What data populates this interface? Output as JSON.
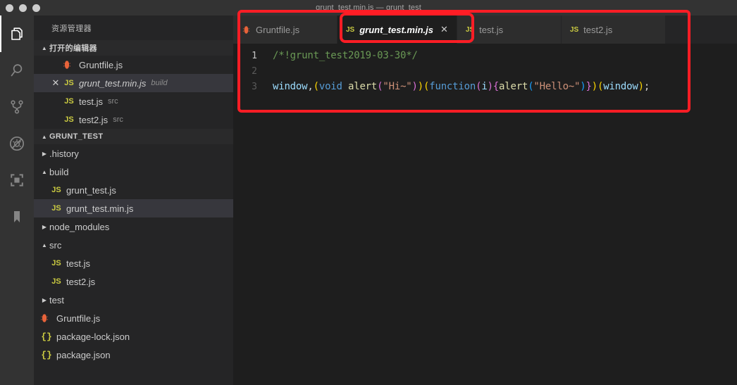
{
  "titlebar": {
    "title": "grunt_test.min.js — grunt_test",
    "window_controls": [
      "close",
      "minimize",
      "maximize"
    ]
  },
  "activitybar": {
    "items": [
      {
        "name": "explorer",
        "icon": "files-icon",
        "active": true
      },
      {
        "name": "search",
        "icon": "search-icon",
        "active": false
      },
      {
        "name": "source-control",
        "icon": "source-control-icon",
        "active": false
      },
      {
        "name": "debug",
        "icon": "debug-no-icon",
        "active": false
      },
      {
        "name": "extensions",
        "icon": "extensions-icon",
        "active": false
      },
      {
        "name": "bookmarks",
        "icon": "bookmark-icon",
        "active": false
      }
    ]
  },
  "sidebar": {
    "title": "资源管理器",
    "open_editors": {
      "header": "打开的编辑器",
      "twisty": "▲",
      "items": [
        {
          "icon": "grunt-icon",
          "name": "Gruntfile.js",
          "desc": "",
          "selected": false,
          "dirty": false,
          "italic": false
        },
        {
          "icon": "js-icon",
          "name": "grunt_test.min.js",
          "desc": "build",
          "selected": true,
          "dirty": false,
          "italic": true
        },
        {
          "icon": "js-icon",
          "name": "test.js",
          "desc": "src",
          "selected": false,
          "dirty": false,
          "italic": false
        },
        {
          "icon": "js-icon",
          "name": "test2.js",
          "desc": "src",
          "selected": false,
          "dirty": false,
          "italic": false
        }
      ]
    },
    "workspace": {
      "header": "GRUNT_TEST",
      "twisty": "▲",
      "items": [
        {
          "type": "folder",
          "name": ".history",
          "expanded": false,
          "selected": false,
          "icon": "chevron-right-icon",
          "indent": 1
        },
        {
          "type": "folder",
          "name": "build",
          "expanded": true,
          "selected": false,
          "icon": "chevron-down-icon",
          "indent": 1
        },
        {
          "type": "file",
          "name": "grunt_test.js",
          "selected": false,
          "icon": "js-icon",
          "indent": 2
        },
        {
          "type": "file",
          "name": "grunt_test.min.js",
          "selected": true,
          "icon": "js-icon",
          "indent": 2
        },
        {
          "type": "folder",
          "name": "node_modules",
          "expanded": false,
          "selected": false,
          "icon": "chevron-right-icon",
          "indent": 1
        },
        {
          "type": "folder",
          "name": "src",
          "expanded": true,
          "selected": false,
          "icon": "chevron-down-icon",
          "indent": 1
        },
        {
          "type": "file",
          "name": "test.js",
          "selected": false,
          "icon": "js-icon",
          "indent": 2
        },
        {
          "type": "file",
          "name": "test2.js",
          "selected": false,
          "icon": "js-icon",
          "indent": 2
        },
        {
          "type": "folder",
          "name": "test",
          "expanded": false,
          "selected": false,
          "icon": "chevron-right-icon",
          "indent": 1
        },
        {
          "type": "file",
          "name": "Gruntfile.js",
          "selected": false,
          "icon": "grunt-icon",
          "indent": 1
        },
        {
          "type": "file",
          "name": "package-lock.json",
          "selected": false,
          "icon": "json-icon",
          "indent": 1
        },
        {
          "type": "file",
          "name": "package.json",
          "selected": false,
          "icon": "json-icon",
          "indent": 1
        }
      ]
    }
  },
  "editor": {
    "tabs": [
      {
        "label": "Gruntfile.js",
        "icon": "grunt-icon",
        "active": false,
        "closable": false
      },
      {
        "label": "grunt_test.min.js",
        "icon": "js-icon",
        "active": true,
        "closable": true,
        "close_glyph": "✕"
      },
      {
        "label": "test.js",
        "icon": "js-icon",
        "active": false,
        "closable": false
      },
      {
        "label": "test2.js",
        "icon": "js-icon",
        "active": false,
        "closable": false
      }
    ],
    "lines": [
      {
        "number": "1",
        "current": true,
        "plain": "/*!grunt_test2019-03-30*/"
      },
      {
        "number": "2",
        "current": false,
        "plain": ""
      },
      {
        "number": "3",
        "current": false,
        "plain": "window,(void alert(\"Hi~\"))(function(i){alert(\"Hello~\")})(window);"
      }
    ]
  },
  "annotations": {
    "outer_box_color": "#ff1d25",
    "tab_box_color": "#ff1d25"
  },
  "colors": {
    "titlebar_bg": "#333333",
    "activitybar_bg": "#333333",
    "sidebar_bg": "#252526",
    "editor_bg": "#1e1e1e",
    "tab_inactive_bg": "#2d2d2d",
    "selection_bg": "#37373d",
    "accent_red": "#ff1d25",
    "js_yellow": "#cbcb41",
    "grunt_orange": "#e8633a",
    "comment_green": "#6a9955",
    "string_orange": "#ce9178",
    "keyword_blue": "#569cd6",
    "function_yellow": "#dcdcaa",
    "variable_blue": "#9cdcfe",
    "bracket_gold": "#ffd700",
    "bracket_pink": "#da70d6",
    "bracket_blue": "#179fff"
  }
}
